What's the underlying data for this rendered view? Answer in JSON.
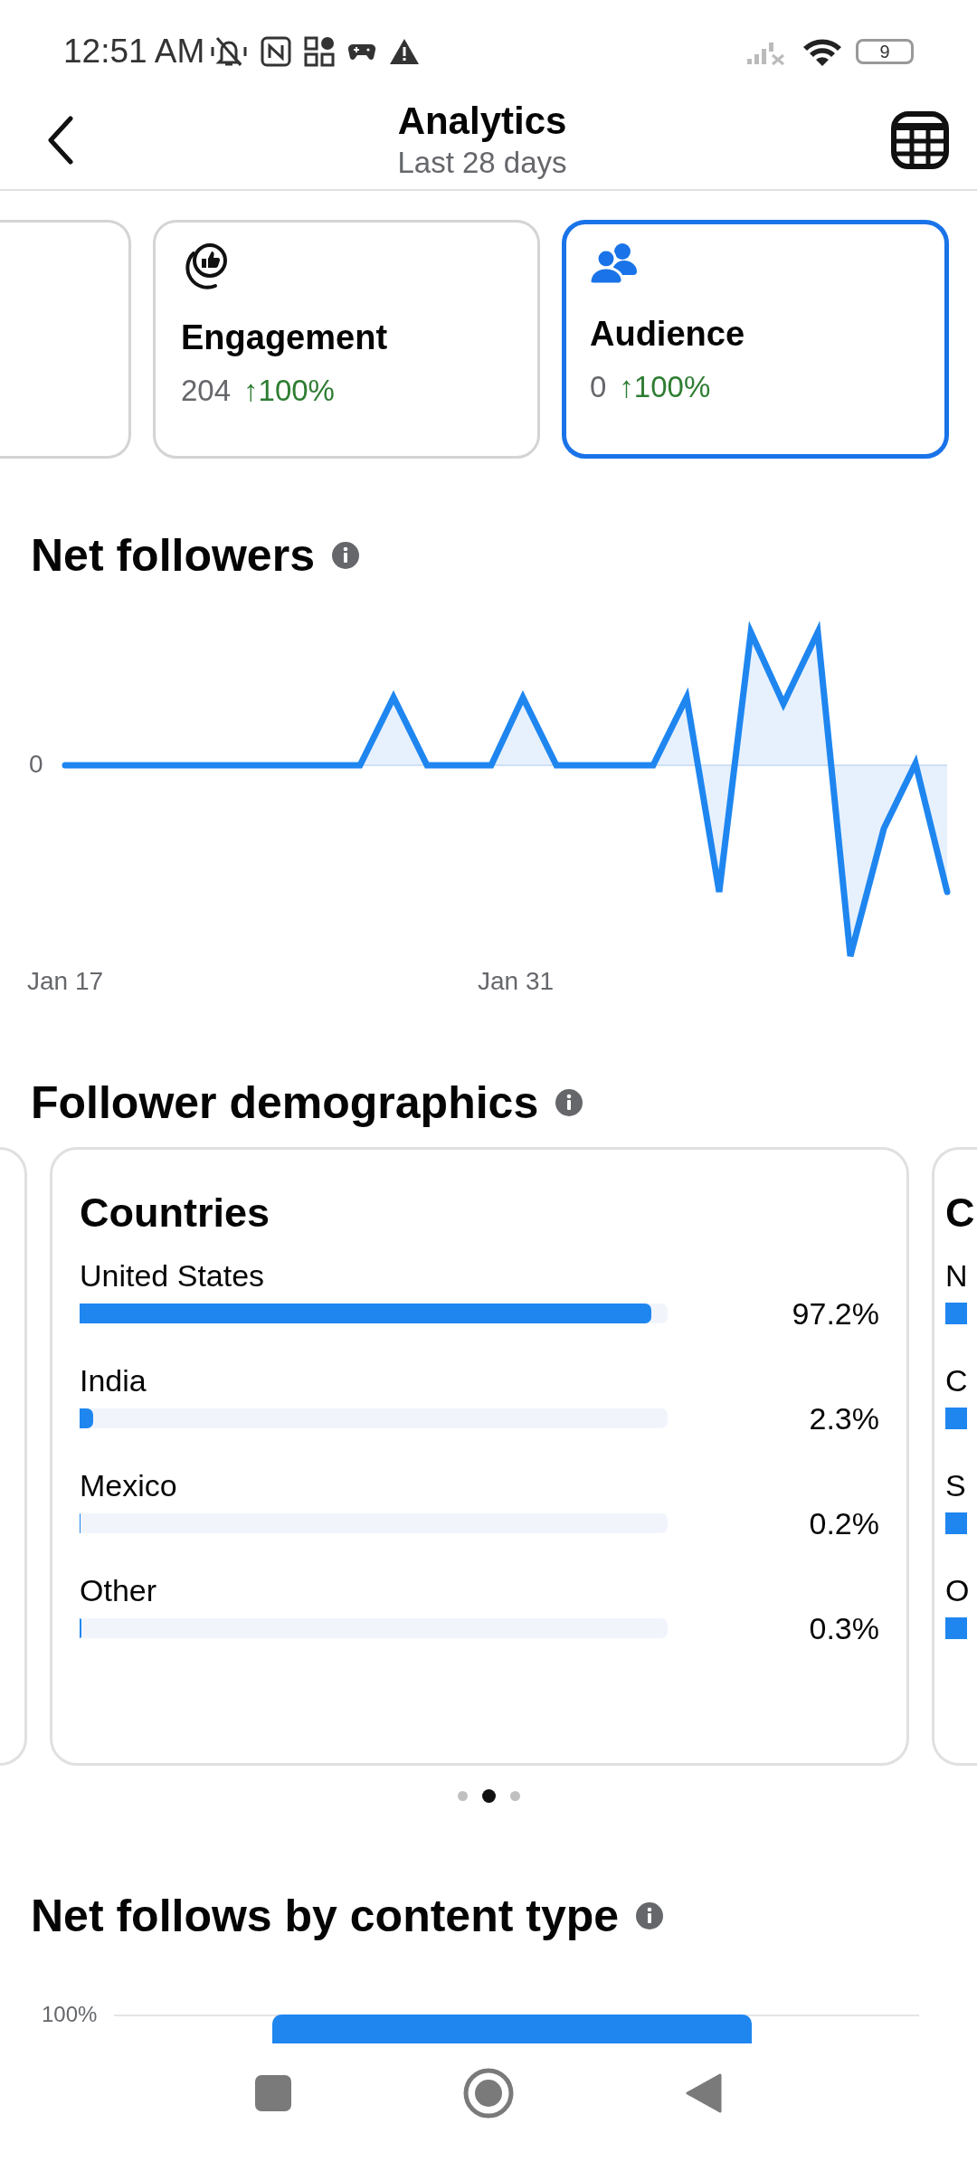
{
  "status_bar": {
    "time": "12:51 AM",
    "battery": "9"
  },
  "header": {
    "title": "Analytics",
    "subtitle": "Last 28 days"
  },
  "metric_cards": [
    {
      "kind": "partial",
      "selected": false
    },
    {
      "kind": "engagement",
      "title": "Engagement",
      "value": "204",
      "change": "↑100%",
      "selected": false
    },
    {
      "kind": "audience",
      "title": "Audience",
      "value": "0",
      "change": "↑100%",
      "selected": true
    }
  ],
  "net_followers": {
    "title": "Net followers",
    "y_tick": "0",
    "x_labels": [
      "Jan 17",
      "Jan 31"
    ]
  },
  "demographics": {
    "title": "Follower demographics",
    "cards": [
      {
        "kind": "partial"
      },
      {
        "kind": "full",
        "title": "Countries",
        "rows": [
          {
            "label": "United States",
            "value": "97.2%",
            "level": 0.972
          },
          {
            "label": "India",
            "value": "2.3%",
            "level": 0.023
          },
          {
            "label": "Mexico",
            "value": "0.2%",
            "level": 0.002
          },
          {
            "label": "Other",
            "value": "0.3%",
            "level": 0.003
          }
        ]
      },
      {
        "kind": "cut",
        "title": "C",
        "rows": [
          {
            "label": "N"
          },
          {
            "label": "C"
          },
          {
            "label": "S"
          },
          {
            "label": "O"
          }
        ]
      }
    ],
    "pages": [
      {
        "selected": false
      },
      {
        "selected": true
      },
      {
        "selected": false
      }
    ]
  },
  "content_type": {
    "title": "Net follows by content type",
    "y_tick": "100%"
  }
}
